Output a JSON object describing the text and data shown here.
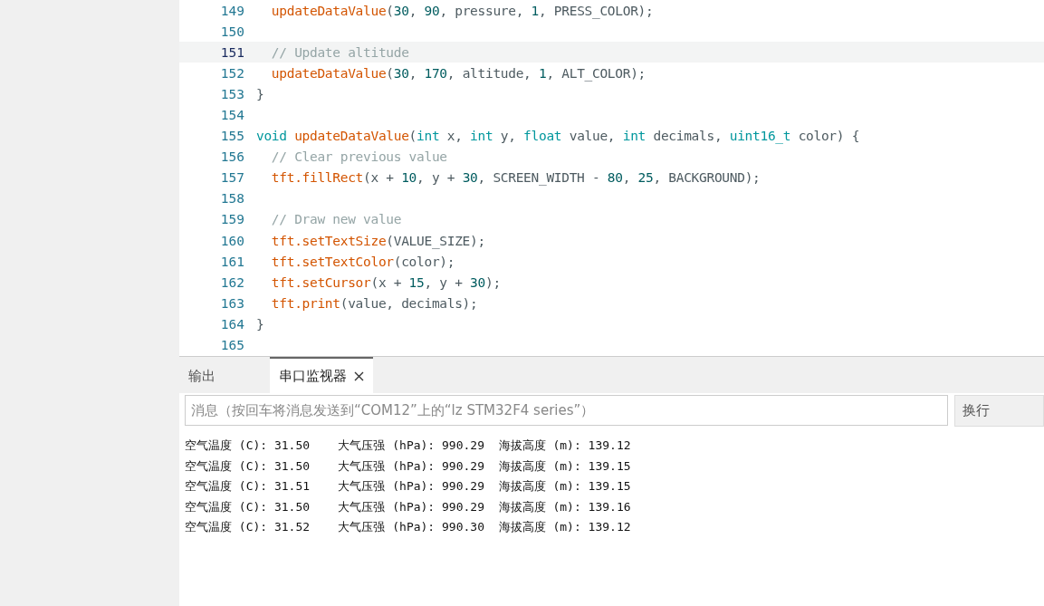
{
  "editor": {
    "lines": [
      {
        "number": "149",
        "current": false,
        "tokens": [
          {
            "kind": "function",
            "text": "  updateDataValue"
          },
          {
            "kind": "plain",
            "text": "("
          },
          {
            "kind": "number",
            "text": "30"
          },
          {
            "kind": "plain",
            "text": ", "
          },
          {
            "kind": "number",
            "text": "90"
          },
          {
            "kind": "plain",
            "text": ", pressure, "
          },
          {
            "kind": "number",
            "text": "1"
          },
          {
            "kind": "plain",
            "text": ", PRESS_COLOR);"
          }
        ]
      },
      {
        "number": "150",
        "current": false
      },
      {
        "number": "151",
        "current": true,
        "tokens": [
          {
            "kind": "comment",
            "text": "  // Update altitude"
          }
        ]
      },
      {
        "number": "152",
        "current": false,
        "tokens": [
          {
            "kind": "function",
            "text": "  updateDataValue"
          },
          {
            "kind": "plain",
            "text": "("
          },
          {
            "kind": "number",
            "text": "30"
          },
          {
            "kind": "plain",
            "text": ", "
          },
          {
            "kind": "number",
            "text": "170"
          },
          {
            "kind": "plain",
            "text": ", altitude, "
          },
          {
            "kind": "number",
            "text": "1"
          },
          {
            "kind": "plain",
            "text": ", ALT_COLOR);"
          }
        ]
      },
      {
        "number": "153",
        "current": false,
        "tokens": [
          {
            "kind": "plain",
            "text": "}"
          }
        ]
      },
      {
        "number": "154",
        "current": false
      },
      {
        "number": "155",
        "current": false,
        "tokens": [
          {
            "kind": "type",
            "text": "void "
          },
          {
            "kind": "function",
            "text": "updateDataValue"
          },
          {
            "kind": "plain",
            "text": "("
          },
          {
            "kind": "type",
            "text": "int"
          },
          {
            "kind": "plain",
            "text": " x, "
          },
          {
            "kind": "type",
            "text": "int"
          },
          {
            "kind": "plain",
            "text": " y, "
          },
          {
            "kind": "type",
            "text": "float"
          },
          {
            "kind": "plain",
            "text": " value, "
          },
          {
            "kind": "type",
            "text": "int"
          },
          {
            "kind": "plain",
            "text": " decimals, "
          },
          {
            "kind": "type",
            "text": "uint16_t"
          },
          {
            "kind": "plain",
            "text": " color) {"
          }
        ]
      },
      {
        "number": "156",
        "current": false,
        "tokens": [
          {
            "kind": "comment",
            "text": "  // Clear previous value"
          }
        ]
      },
      {
        "number": "157",
        "current": false,
        "tokens": [
          {
            "kind": "function",
            "text": "  tft.fillRect"
          },
          {
            "kind": "plain",
            "text": "(x + "
          },
          {
            "kind": "number",
            "text": "10"
          },
          {
            "kind": "plain",
            "text": ", y + "
          },
          {
            "kind": "number",
            "text": "30"
          },
          {
            "kind": "plain",
            "text": ", SCREEN_WIDTH - "
          },
          {
            "kind": "number",
            "text": "80"
          },
          {
            "kind": "plain",
            "text": ", "
          },
          {
            "kind": "number",
            "text": "25"
          },
          {
            "kind": "plain",
            "text": ", BACKGROUND);"
          }
        ]
      },
      {
        "number": "158",
        "current": false
      },
      {
        "number": "159",
        "current": false,
        "tokens": [
          {
            "kind": "comment",
            "text": "  // Draw new value"
          }
        ]
      },
      {
        "number": "160",
        "current": false,
        "tokens": [
          {
            "kind": "function",
            "text": "  tft.setTextSize"
          },
          {
            "kind": "plain",
            "text": "(VALUE_SIZE);"
          }
        ]
      },
      {
        "number": "161",
        "current": false,
        "tokens": [
          {
            "kind": "function",
            "text": "  tft.setTextColor"
          },
          {
            "kind": "plain",
            "text": "(color);"
          }
        ]
      },
      {
        "number": "162",
        "current": false,
        "tokens": [
          {
            "kind": "function",
            "text": "  tft.setCursor"
          },
          {
            "kind": "plain",
            "text": "(x + "
          },
          {
            "kind": "number",
            "text": "15"
          },
          {
            "kind": "plain",
            "text": ", y + "
          },
          {
            "kind": "number",
            "text": "30"
          },
          {
            "kind": "plain",
            "text": ");"
          }
        ]
      },
      {
        "number": "163",
        "current": false,
        "tokens": [
          {
            "kind": "function",
            "text": "  tft.print"
          },
          {
            "kind": "plain",
            "text": "(value, decimals);"
          }
        ]
      },
      {
        "number": "164",
        "current": false,
        "tokens": [
          {
            "kind": "plain",
            "text": "}"
          }
        ]
      },
      {
        "number": "165",
        "current": false
      }
    ]
  },
  "panel": {
    "tabs": [
      {
        "label": "输出",
        "selected": false,
        "closable": false
      },
      {
        "label": "串口监视器",
        "selected": true,
        "closable": true
      }
    ],
    "message": {
      "placeholder": "消息（按回车将消息发送到“COM12”上的“lz STM32F4 series”）"
    },
    "line_ending": "换行",
    "output": [
      "空气温度 (C): 31.50    大气压强 (hPa): 990.29  海拔高度 (m): 139.12",
      "空气温度 (C): 31.50    大气压强 (hPa): 990.29  海拔高度 (m): 139.15",
      "空气温度 (C): 31.51    大气压强 (hPa): 990.29  海拔高度 (m): 139.15",
      "空气温度 (C): 31.50    大气压强 (hPa): 990.29  海拔高度 (m): 139.16",
      "空气温度 (C): 31.52    大气压强 (hPa): 990.30  海拔高度 (m): 139.12"
    ]
  }
}
